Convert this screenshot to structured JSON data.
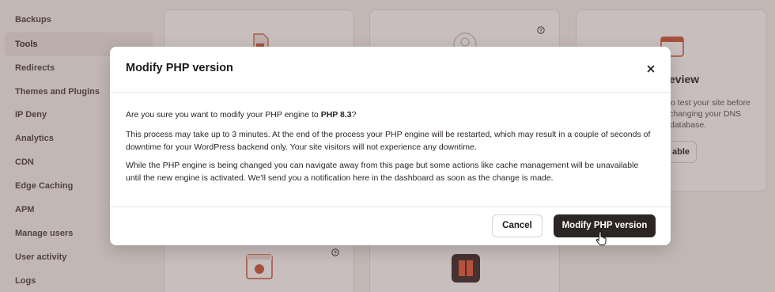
{
  "sidebar": {
    "items": [
      {
        "label": "Backups"
      },
      {
        "label": "Tools",
        "active": true
      },
      {
        "label": "Redirects"
      },
      {
        "label": "Themes and Plugins"
      },
      {
        "label": "IP Deny"
      },
      {
        "label": "Analytics"
      },
      {
        "label": "CDN"
      },
      {
        "label": "Edge Caching"
      },
      {
        "label": "APM"
      },
      {
        "label": "Manage users"
      },
      {
        "label": "User activity"
      },
      {
        "label": "Logs"
      }
    ]
  },
  "background_card": {
    "title_fragment": "eview",
    "text_lines": [
      "o test your site before",
      "changing your DNS",
      "database."
    ],
    "button_fragment": "able"
  },
  "modal": {
    "title": "Modify PHP version",
    "intro_prefix": "Are you sure you want to modify your PHP engine to ",
    "intro_version": "PHP 8.3",
    "intro_suffix": "?",
    "paragraph_1": "This process may take up to 3 minutes. At the end of the process your PHP engine will be restarted, which may result in a couple of seconds of downtime for your WordPress backend only. Your site visitors will not experience any downtime.",
    "paragraph_2": "While the PHP engine is being changed you can navigate away from this page but some actions like cache management will be unavailable until the new engine is activated. We'll send you a notification here in the dashboard as soon as the change is made.",
    "cancel_label": "Cancel",
    "confirm_label": "Modify PHP version"
  },
  "colors": {
    "primary_button": "#2b2524",
    "overlay": "#5f4440",
    "accent_icon": "#c9573c"
  },
  "icons": [
    "close-icon",
    "help-icon",
    "file-icon",
    "user-circle-icon",
    "browser-window-icon",
    "pause-icon",
    "pointer-hand-icon"
  ]
}
